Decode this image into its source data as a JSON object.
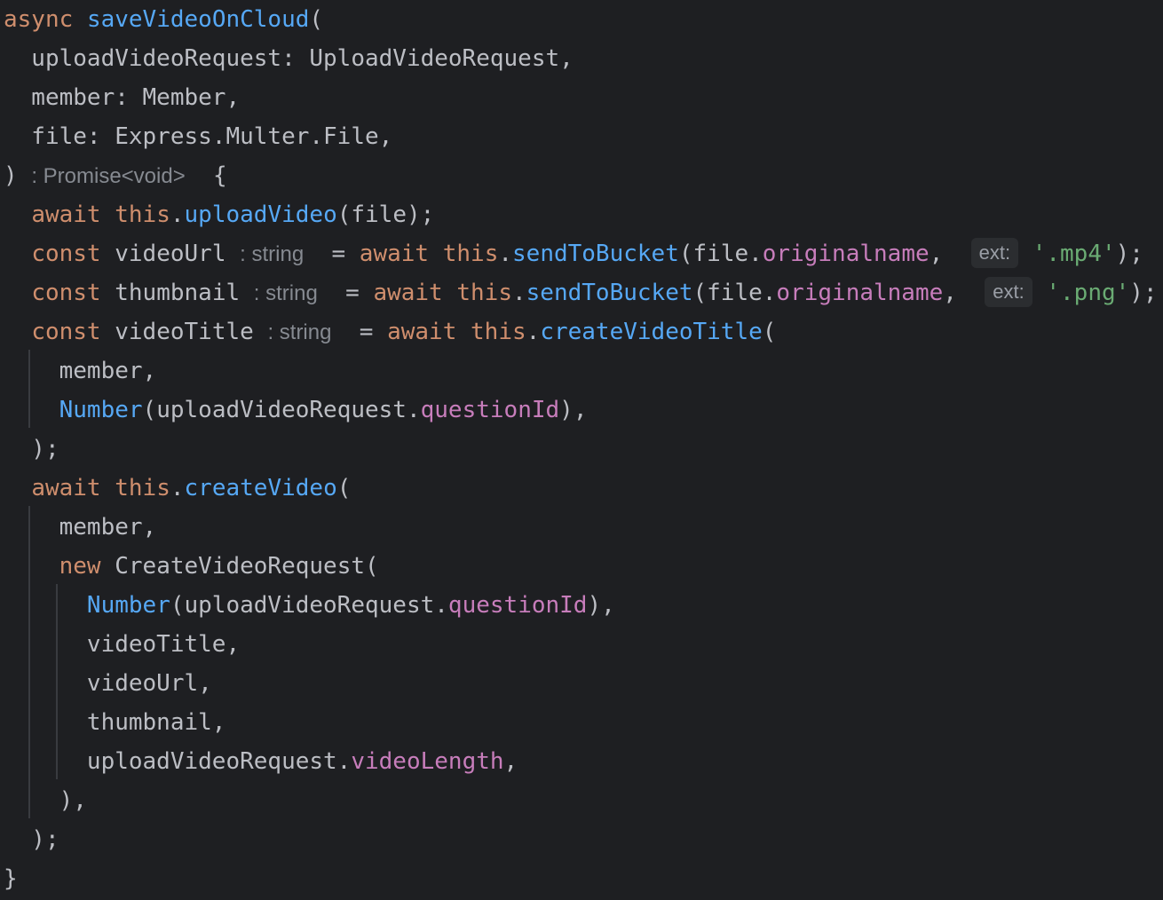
{
  "editor": {
    "lines": [
      [
        {
          "t": "async",
          "c": "kw"
        },
        {
          "t": " "
        },
        {
          "t": "saveVideoOnCloud",
          "c": "fn"
        },
        {
          "t": "("
        }
      ],
      [
        {
          "t": "  uploadVideoRequest: UploadVideoRequest,"
        }
      ],
      [
        {
          "t": "  member: Member,"
        }
      ],
      [
        {
          "t": "  file: Express.Multer.File,"
        }
      ],
      [
        {
          "t": ") "
        },
        {
          "t": ": Promise<void>",
          "c": "hint-type"
        },
        {
          "t": "  {"
        }
      ],
      [
        {
          "t": "  "
        },
        {
          "t": "await",
          "c": "kw"
        },
        {
          "t": " "
        },
        {
          "t": "this",
          "c": "kw"
        },
        {
          "t": "."
        },
        {
          "t": "uploadVideo",
          "c": "fn"
        },
        {
          "t": "(file);"
        }
      ],
      [
        {
          "t": "  "
        },
        {
          "t": "const",
          "c": "kw"
        },
        {
          "t": " videoUrl "
        },
        {
          "t": ": string",
          "c": "hint-type"
        },
        {
          "t": "  = "
        },
        {
          "t": "await",
          "c": "kw"
        },
        {
          "t": " "
        },
        {
          "t": "this",
          "c": "kw"
        },
        {
          "t": "."
        },
        {
          "t": "sendToBucket",
          "c": "fn"
        },
        {
          "t": "(file."
        },
        {
          "t": "originalname",
          "c": "prop"
        },
        {
          "t": ",  "
        },
        {
          "t": "ext:",
          "c": "hint-param"
        },
        {
          "t": " "
        },
        {
          "t": "'.mp4'",
          "c": "str"
        },
        {
          "t": ");"
        }
      ],
      [
        {
          "t": "  "
        },
        {
          "t": "const",
          "c": "kw"
        },
        {
          "t": " thumbnail "
        },
        {
          "t": ": string",
          "c": "hint-type"
        },
        {
          "t": "  = "
        },
        {
          "t": "await",
          "c": "kw"
        },
        {
          "t": " "
        },
        {
          "t": "this",
          "c": "kw"
        },
        {
          "t": "."
        },
        {
          "t": "sendToBucket",
          "c": "fn"
        },
        {
          "t": "(file."
        },
        {
          "t": "originalname",
          "c": "prop"
        },
        {
          "t": ",  "
        },
        {
          "t": "ext:",
          "c": "hint-param"
        },
        {
          "t": " "
        },
        {
          "t": "'.png'",
          "c": "str"
        },
        {
          "t": ");"
        }
      ],
      [
        {
          "t": "  "
        },
        {
          "t": "const",
          "c": "kw"
        },
        {
          "t": " videoTitle "
        },
        {
          "t": ": string",
          "c": "hint-type"
        },
        {
          "t": "  = "
        },
        {
          "t": "await",
          "c": "kw"
        },
        {
          "t": " "
        },
        {
          "t": "this",
          "c": "kw"
        },
        {
          "t": "."
        },
        {
          "t": "createVideoTitle",
          "c": "fn"
        },
        {
          "t": "("
        }
      ],
      [
        {
          "t": "    member,"
        }
      ],
      [
        {
          "t": "    "
        },
        {
          "t": "Number",
          "c": "fn"
        },
        {
          "t": "(uploadVideoRequest."
        },
        {
          "t": "questionId",
          "c": "prop"
        },
        {
          "t": "),"
        }
      ],
      [
        {
          "t": "  );"
        }
      ],
      [
        {
          "t": "  "
        },
        {
          "t": "await",
          "c": "kw"
        },
        {
          "t": " "
        },
        {
          "t": "this",
          "c": "kw"
        },
        {
          "t": "."
        },
        {
          "t": "createVideo",
          "c": "fn"
        },
        {
          "t": "("
        }
      ],
      [
        {
          "t": "    member,"
        }
      ],
      [
        {
          "t": "    "
        },
        {
          "t": "new",
          "c": "kw"
        },
        {
          "t": " CreateVideoRequest("
        }
      ],
      [
        {
          "t": "      "
        },
        {
          "t": "Number",
          "c": "fn"
        },
        {
          "t": "(uploadVideoRequest."
        },
        {
          "t": "questionId",
          "c": "prop"
        },
        {
          "t": "),"
        }
      ],
      [
        {
          "t": "      videoTitle,"
        }
      ],
      [
        {
          "t": "      videoUrl,"
        }
      ],
      [
        {
          "t": "      thumbnail,"
        }
      ],
      [
        {
          "t": "      uploadVideoRequest."
        },
        {
          "t": "videoLength",
          "c": "prop"
        },
        {
          "t": ","
        }
      ],
      [
        {
          "t": "    ),"
        }
      ],
      [
        {
          "t": "  );"
        }
      ],
      [
        {
          "t": "}"
        }
      ]
    ]
  },
  "colors": {
    "background": "#1e1f22",
    "text": "#bcbec4",
    "keyword": "#cf8e6d",
    "function": "#56a8f5",
    "property": "#c77dbb",
    "string": "#6aab73",
    "inlay_hint": "#868a91",
    "inlay_hint_background": "#2b2d30",
    "indent_guide": "#393b40"
  }
}
